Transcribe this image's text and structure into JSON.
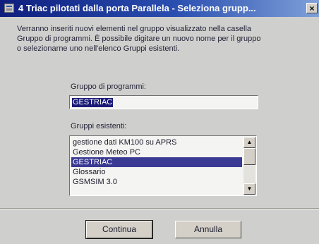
{
  "window": {
    "title": "4 Triac pilotati dalla  porta Parallela - Seleziona grupp...",
    "close_symbol": "×",
    "icon": "setup-app-icon"
  },
  "description": {
    "lines": [
      "Verranno inseriti nuovi elementi nel gruppo visualizzato nella casella",
      "Gruppo di programmi. È possibile digitare un nuovo nome per il gruppo",
      "o selezionarne uno nell'elenco Gruppi esistenti."
    ]
  },
  "program_group": {
    "label": "Gruppo di programmi:",
    "value": "GESTRIAC"
  },
  "existing_groups": {
    "label": "Gruppi esistenti:",
    "items": [
      "gestione  dati  KM100 su  APRS",
      "Gestione Meteo PC",
      "GESTRIAC",
      "Glossario",
      "GSMSIM 3.0"
    ],
    "selected": "GESTRIAC",
    "scroll_up_symbol": "▲",
    "scroll_down_symbol": "▼"
  },
  "buttons": {
    "continue": "Continua",
    "cancel": "Annulla"
  },
  "colors": {
    "title_start": "#0e1e7e",
    "title_end": "#7fa0d8",
    "selection": "#3a3a94",
    "dialog_bg": "#cfcfcd"
  }
}
